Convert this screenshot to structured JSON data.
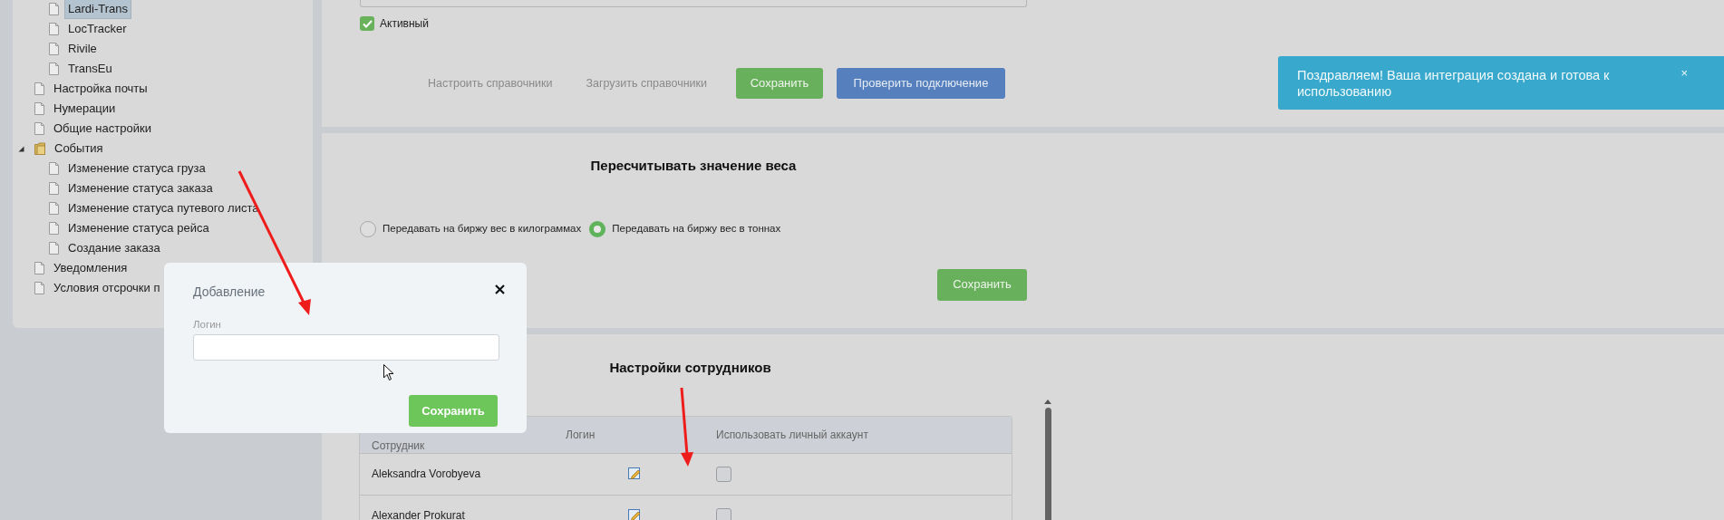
{
  "tree": {
    "partial_children": [
      {
        "label": "Lardi-Trans",
        "selected": true
      },
      {
        "label": "LocTracker",
        "selected": false
      },
      {
        "label": "Rivile",
        "selected": false
      },
      {
        "label": "TransEu",
        "selected": false
      }
    ],
    "items": [
      {
        "label": "Настройка почты",
        "selected": false
      },
      {
        "label": "Нумерации",
        "selected": false
      },
      {
        "label": "Общие настройки",
        "selected": false
      },
      {
        "label": "События",
        "selected": false,
        "expanded": true,
        "children": [
          {
            "label": "Изменение статуса груза",
            "selected": false
          },
          {
            "label": "Изменение статуса заказа",
            "selected": false
          },
          {
            "label": "Изменение статуса путевого листа",
            "selected": false
          },
          {
            "label": "Изменение статуса рейса",
            "selected": false
          },
          {
            "label": "Создание заказа",
            "selected": false
          }
        ]
      },
      {
        "label": "Уведомления",
        "selected": false
      },
      {
        "label": "Условия отсрочки п",
        "selected": false
      }
    ]
  },
  "integration": {
    "active": {
      "label": "Активный",
      "checked": true
    },
    "links": [
      "Настроить справочники",
      "Загрузить справочники"
    ],
    "save_button": "Сохранить",
    "test_button": "Проверить подключение"
  },
  "weight": {
    "title": "Пересчитывать значение веса",
    "options": [
      {
        "label": "Передавать на биржу вес в килограммах",
        "selected": false
      },
      {
        "label": "Передавать на биржу вес в тоннах",
        "selected": true
      }
    ],
    "save_button": "Сохранить"
  },
  "employees": {
    "title": "Настройки сотрудников",
    "columns": [
      "Сотрудник",
      "Логин",
      "Использовать личный аккаунт"
    ],
    "rows": [
      {
        "name": "Aleksandra Vorobyeva",
        "personal_account": false
      },
      {
        "name": "Alexander Prokurat",
        "personal_account": false
      }
    ]
  },
  "toast": {
    "message": "Поздравляем! Ваша интеграция создана и готова к использованию",
    "close": "×"
  },
  "dialog": {
    "title": "Добавление",
    "field_label": "Логин",
    "save_button": "Сохранить"
  }
}
